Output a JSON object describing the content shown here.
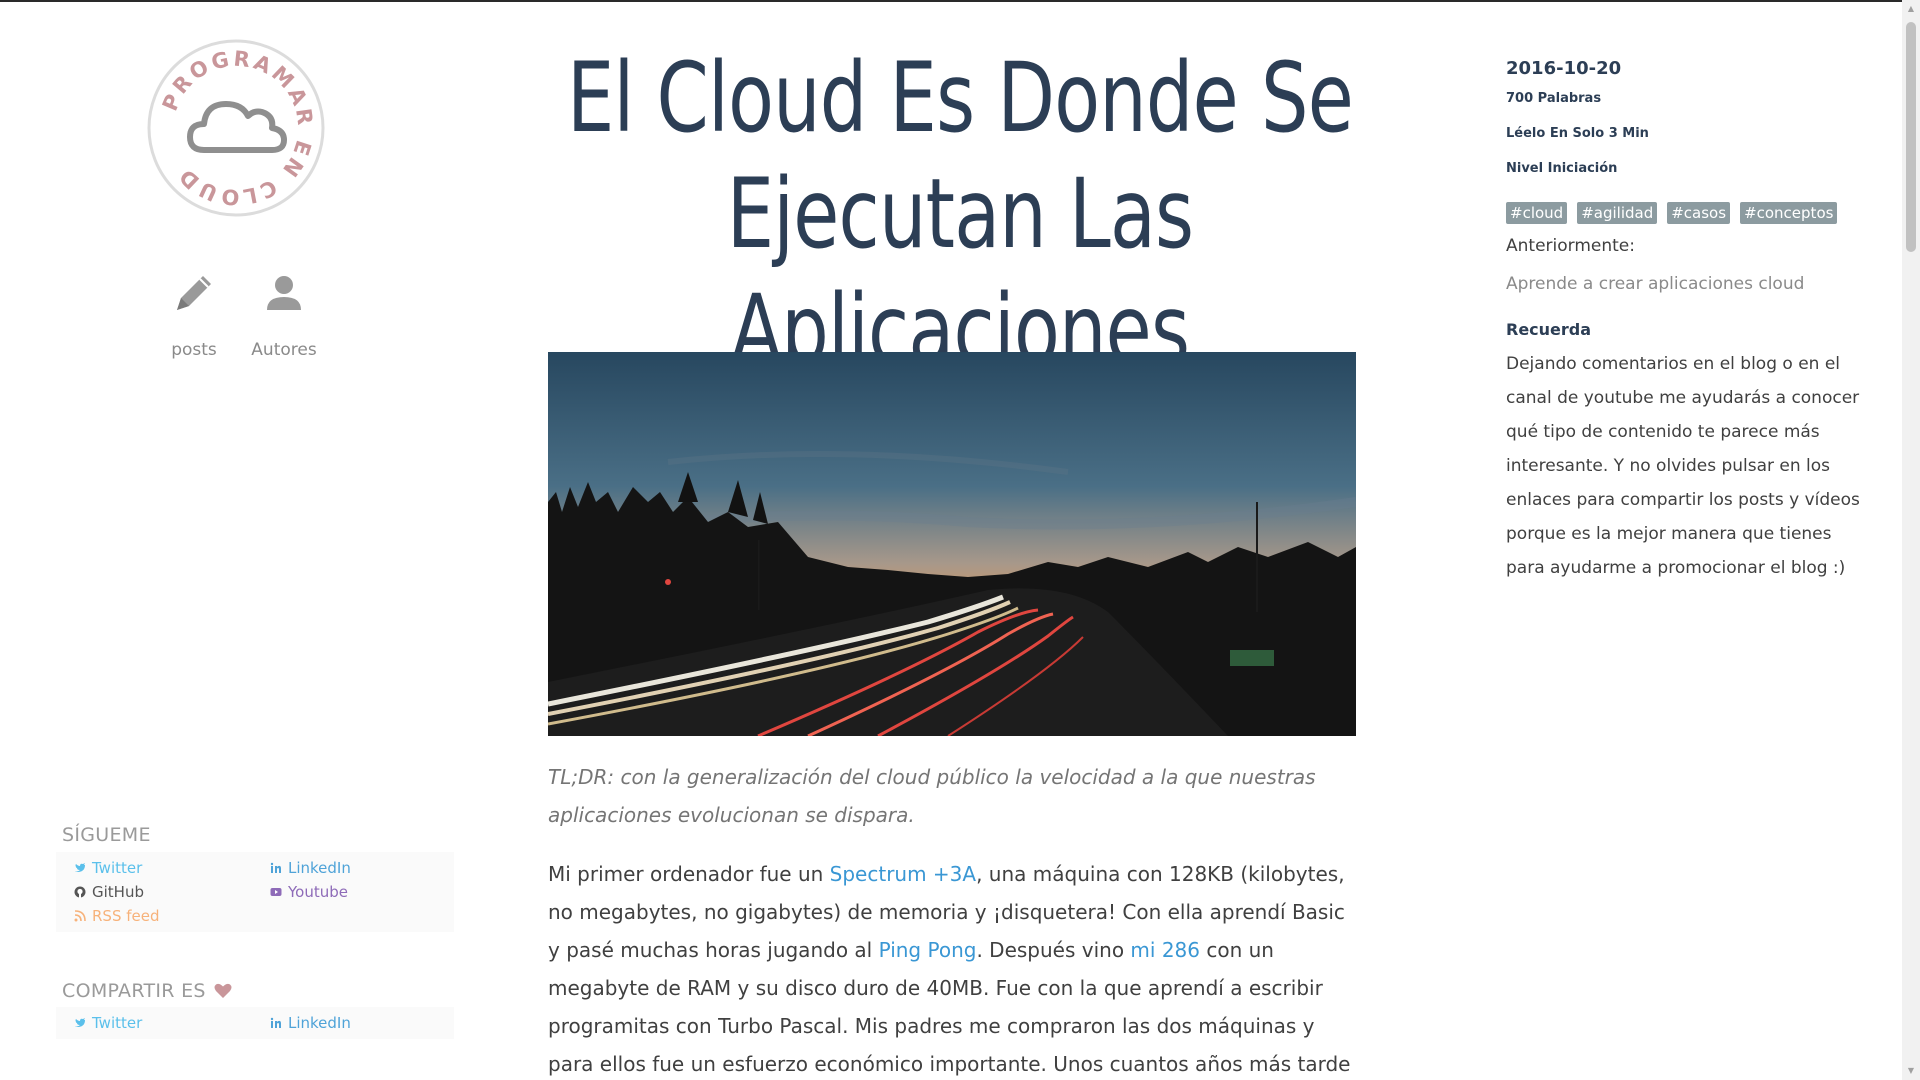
{
  "logo": {
    "text": "PROGRAMAR EN CLOUD",
    "color": "#c9969a"
  },
  "nav": {
    "posts_label": "posts",
    "authors_label": "Autores"
  },
  "follow": {
    "title": "SÍGUEME",
    "links": [
      {
        "label": "Twitter",
        "color": "#5bc0eb",
        "icon": "twitter-icon"
      },
      {
        "label": "LinkedIn",
        "color": "#4fa3d8",
        "icon": "linkedin-icon"
      },
      {
        "label": "GitHub",
        "color": "#555555",
        "icon": "github-icon"
      },
      {
        "label": "Youtube",
        "color": "#8e6bb8",
        "icon": "youtube-icon"
      },
      {
        "label": "RSS feed",
        "color": "#f7b27a",
        "icon": "rss-icon"
      }
    ]
  },
  "share": {
    "title": "COMPARTIR ES",
    "heart_color": "#c9969a",
    "links": [
      {
        "label": "Twitter",
        "color": "#5bc0eb",
        "icon": "twitter-icon"
      },
      {
        "label": "LinkedIn",
        "color": "#4fa3d8",
        "icon": "linkedin-icon"
      }
    ]
  },
  "article": {
    "title_line1": "El Cloud Es Donde Se",
    "title_line2": "Ejecutan Las Aplicaciones",
    "tldr": "TL;DR: con la generalización del cloud público la velocidad a la que nuestras aplicaciones evolucionan se dispara.",
    "para": {
      "t1": "Mi primer ordenador fue un ",
      "link1": "Spectrum +3A",
      "t2": ", una máquina con 128KB (kilobytes, no megabytes, no gigabytes) de memoria y ¡disquetera! Con ella aprendí Basic y pasé muchas horas jugando al ",
      "link2": "Ping Pong",
      "t3": ". Después vino ",
      "link3": "mi 286",
      "t4": " con un megabyte de RAM y su disco duro de 40MB. Fue con la que aprendí a escribir programitas con Turbo Pascal. Mis padres me compraron las dos máquinas y para ellos fue un esfuerzo económico importante. Unos cuantos años más tarde un compañero de"
    }
  },
  "meta": {
    "date": "2016-10-20",
    "words": "700 Palabras",
    "read_time": "Léelo En Solo 3 Min",
    "level": "Nivel Iniciación",
    "tags": [
      "#cloud",
      "#agilidad",
      "#casos",
      "#conceptos"
    ],
    "previous_label": "Anteriormente:",
    "previous_link": "Aprende a crear aplicaciones cloud",
    "remember_title": "Recuerda",
    "remember_text": "Dejando comentarios en el blog o en el canal de youtube me ayudarás a conocer qué tipo de contenido te parece más interesante. Y no olvides pulsar en los enlaces para compartir los posts y vídeos porque es la mejor manera que tienes para ayudarme a promocionar el blog :)"
  }
}
